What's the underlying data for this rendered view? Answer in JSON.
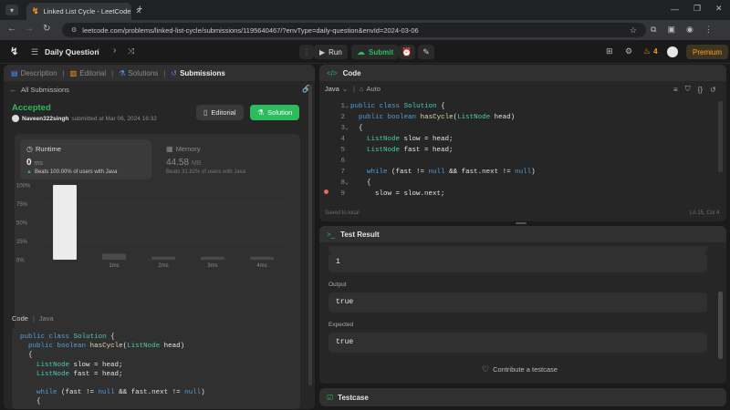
{
  "browser": {
    "tab_title": "Linked List Cycle - LeetCode",
    "url": "leetcode.com/problems/linked-list-cycle/submissions/1195640467/?envType=daily-question&envId=2024-03-06"
  },
  "header": {
    "daily_label": "Daily Question",
    "run_label": "Run",
    "submit_label": "Submit",
    "streak_count": "4",
    "premium_label": "Premium"
  },
  "left_tabs": [
    "Description",
    "Editorial",
    "Solutions",
    "Submissions"
  ],
  "submission": {
    "back_label": "All Submissions",
    "status": "Accepted",
    "user": "Naveen322singh",
    "submitted_text": "submitted at Mar 06, 2024 16:32",
    "editorial_button": "Editorial",
    "solution_button": "Solution",
    "runtime_label": "Runtime",
    "runtime_value": "0",
    "runtime_unit": "ms",
    "runtime_beats": "Beats 100.00% of users with Java",
    "memory_label": "Memory",
    "memory_value": "44.58",
    "memory_unit": "MB",
    "memory_beats": "Beats 31.82% of users with Java",
    "code_label": "Code",
    "language": "Java"
  },
  "chart_data": {
    "type": "bar",
    "y_ticks": [
      "100%",
      "75%",
      "50%",
      "25%",
      "0%"
    ],
    "categories": [
      "",
      "1ms",
      "2ms",
      "3ms",
      "4ms"
    ],
    "values": [
      100,
      8,
      4,
      4,
      4
    ],
    "ylim": [
      0,
      100
    ],
    "minimap_labels": [
      "1ms",
      "2ms",
      "3ms",
      "4ms"
    ]
  },
  "code_panel": {
    "title": "Code",
    "language": "Java",
    "mode": "Auto",
    "saved_text": "Saved to local",
    "cursor_pos": "Ln 15, Col 4",
    "line_numbers": [
      "1",
      "2",
      "3",
      "4",
      "5",
      "6",
      "7",
      "8",
      "9"
    ]
  },
  "test_panel": {
    "title": "Test Result",
    "input_value": "1",
    "output_label": "Output",
    "output_value": "true",
    "expected_label": "Expected",
    "expected_value": "true",
    "contribute_label": "Contribute a testcase",
    "testcase_label": "Testcase"
  },
  "colors": {
    "accent_green": "#2cbb5d",
    "premium_orange": "#ffa116",
    "bg": "#1a1a1a",
    "panel": "#262626"
  }
}
